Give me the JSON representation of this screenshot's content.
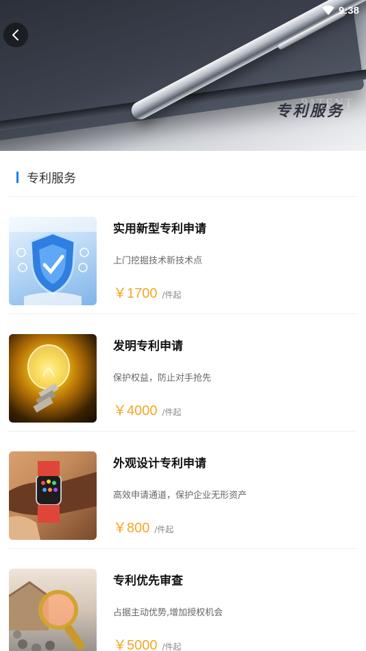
{
  "status_bar": {
    "time": "9:38"
  },
  "banner": {
    "title": "专利服务",
    "watermark": "PATENT"
  },
  "section": {
    "title": "专利服务"
  },
  "items": [
    {
      "title": "实用新型专利申请",
      "desc": "上门挖掘技术新技术点",
      "price": "￥1700",
      "unit": "/件起"
    },
    {
      "title": "发明专利申请",
      "desc": "保护权益，防止对手抢先",
      "price": "￥4000",
      "unit": "/件起"
    },
    {
      "title": "外观设计专利申请",
      "desc": "高效申请通道，保护企业无形资产",
      "price": "￥800",
      "unit": "/件起"
    },
    {
      "title": "专利优先审查",
      "desc": "占据主动优势,增加授权机会",
      "price": "￥5000",
      "unit": "/件起"
    }
  ],
  "colors": {
    "accent": "#1a7cf2",
    "price": "#f5a623"
  },
  "icons": [
    "back-arrow-icon",
    "wifi-icon"
  ]
}
